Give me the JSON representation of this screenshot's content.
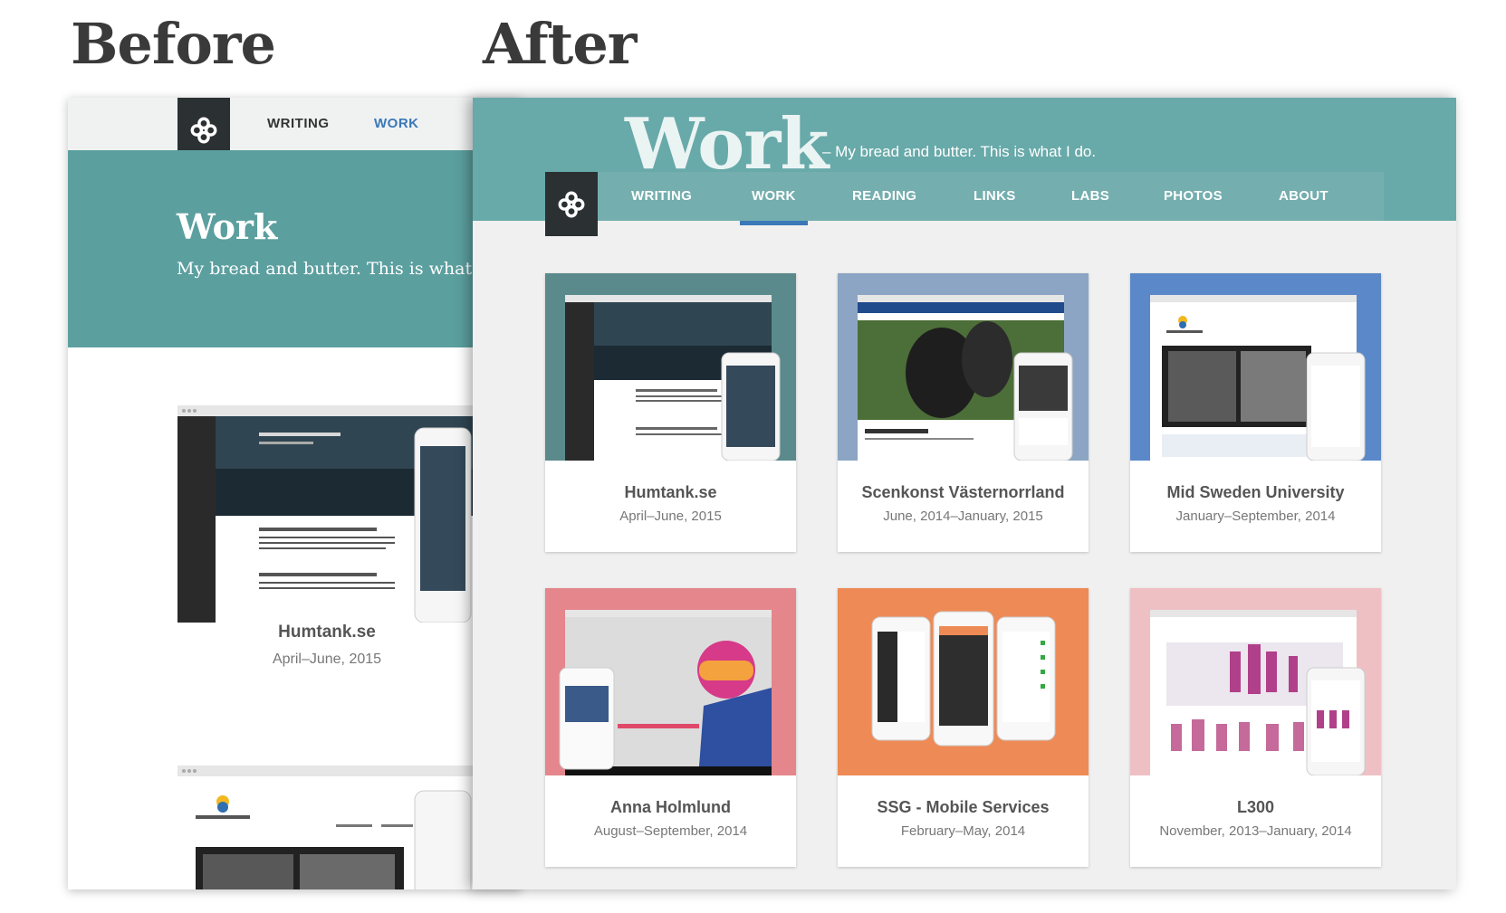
{
  "labels": {
    "before": "Before",
    "after": "After"
  },
  "before": {
    "nav": {
      "writing": "WRITING",
      "work": "WORK"
    },
    "hero": {
      "title": "Work",
      "subtitle": "My bread and butter. This is what I do."
    },
    "projects": [
      {
        "name": "Humtank.se",
        "date": "April–June, 2015"
      }
    ]
  },
  "after": {
    "hero": {
      "title": "Work",
      "subtitle": "– My bread and butter. This is what I do."
    },
    "nav": [
      "WRITING",
      "WORK",
      "READING",
      "LINKS",
      "LABS",
      "PHOTOS",
      "ABOUT"
    ],
    "active_nav": "WORK",
    "projects": [
      {
        "name": "Humtank.se",
        "date": "April–June, 2015",
        "bg": "#5a8a8c"
      },
      {
        "name": "Scenkonst Västernorrland",
        "date": "June, 2014–January, 2015",
        "bg": "#8da5c4"
      },
      {
        "name": "Mid Sweden University",
        "date": "January–September, 2014",
        "bg": "#5b88c8"
      },
      {
        "name": "Anna Holmlund",
        "date": "August–September, 2014",
        "bg": "#e4868c"
      },
      {
        "name": "SSG - Mobile Services",
        "date": "February–May, 2014",
        "bg": "#ee8a55"
      },
      {
        "name": "L300",
        "date": "November, 2013–January, 2014",
        "bg": "#eec0c4"
      }
    ]
  },
  "colors": {
    "accent": "#3a78b8",
    "hero_before": "#5c9f9f",
    "hero_after": "#68a9a9",
    "logo_bg": "#2b3033"
  },
  "icons": {
    "logo": "quatrefoil-logo-icon"
  }
}
